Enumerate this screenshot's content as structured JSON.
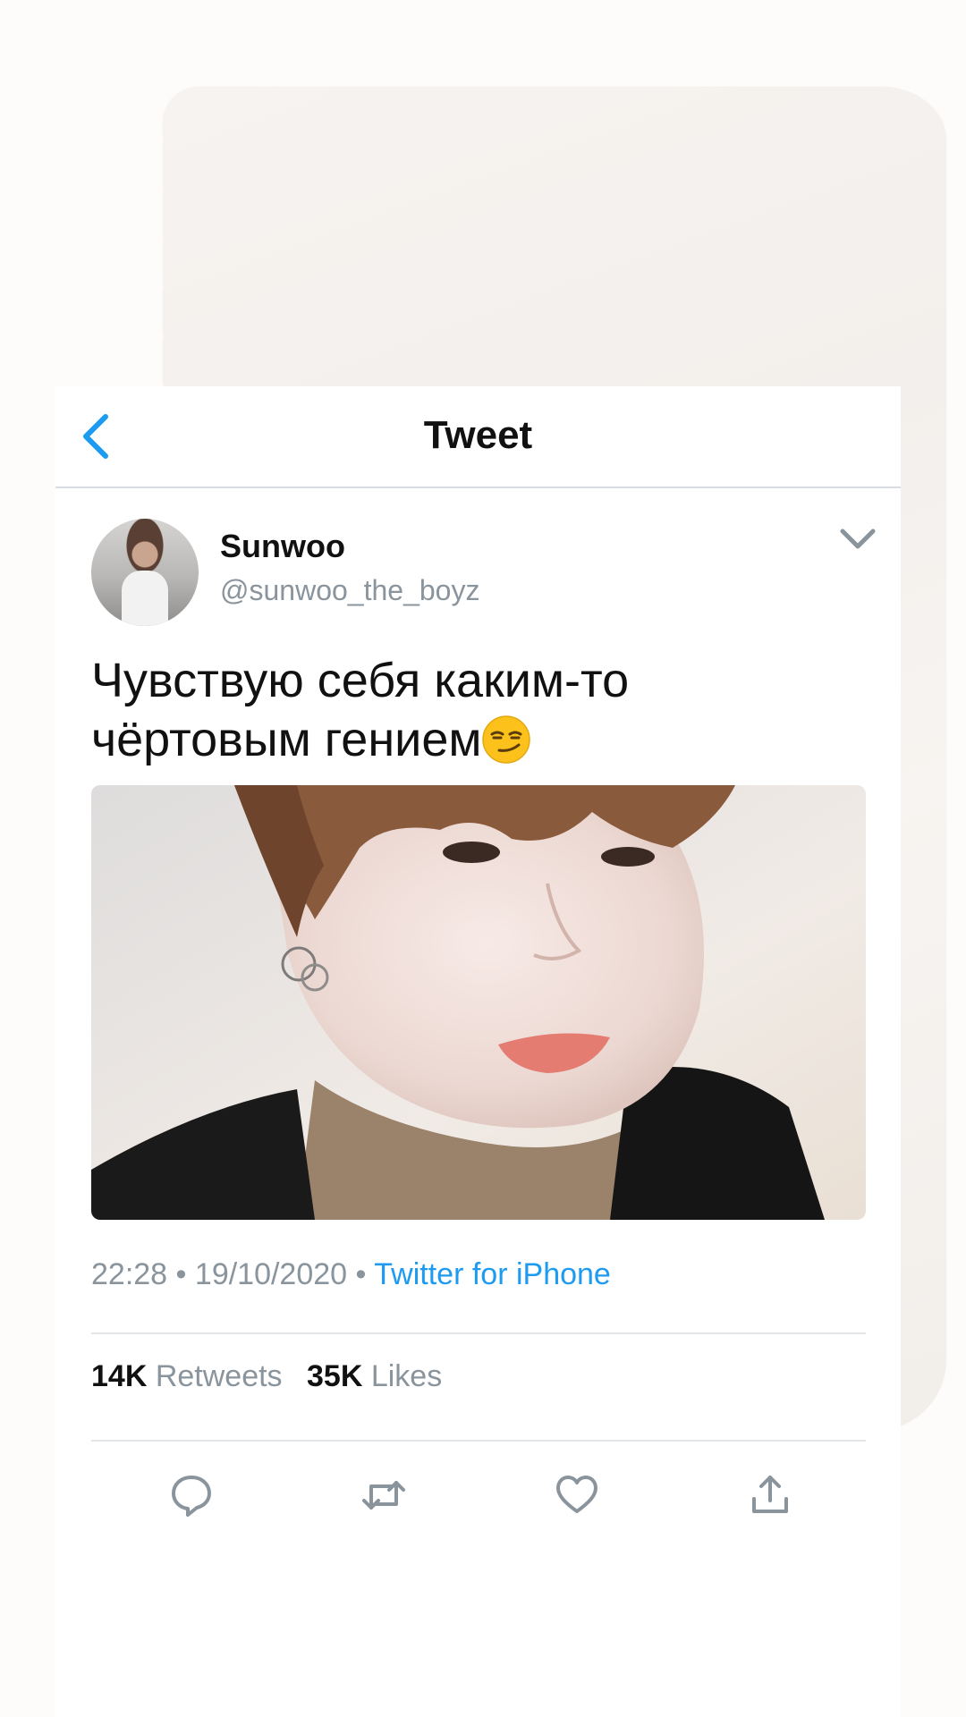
{
  "header": {
    "title": "Tweet",
    "back_icon": "chevron-left-icon",
    "accent_color": "#1d9bf0"
  },
  "tweet": {
    "display_name": "Sunwoo",
    "handle": "@sunwoo_the_boyz",
    "text_line1": "Чувствую себя каким-то",
    "text_line2": "чёртовым гением",
    "emoji": "smirking-face",
    "time": "22:28",
    "date": "19/10/2020",
    "separator": "•",
    "source": "Twitter for iPhone",
    "retweets_count": "14K",
    "retweets_label": "Retweets",
    "likes_count": "35K",
    "likes_label": "Likes"
  },
  "actions": [
    "reply-icon",
    "retweet-icon",
    "like-icon",
    "share-icon"
  ]
}
